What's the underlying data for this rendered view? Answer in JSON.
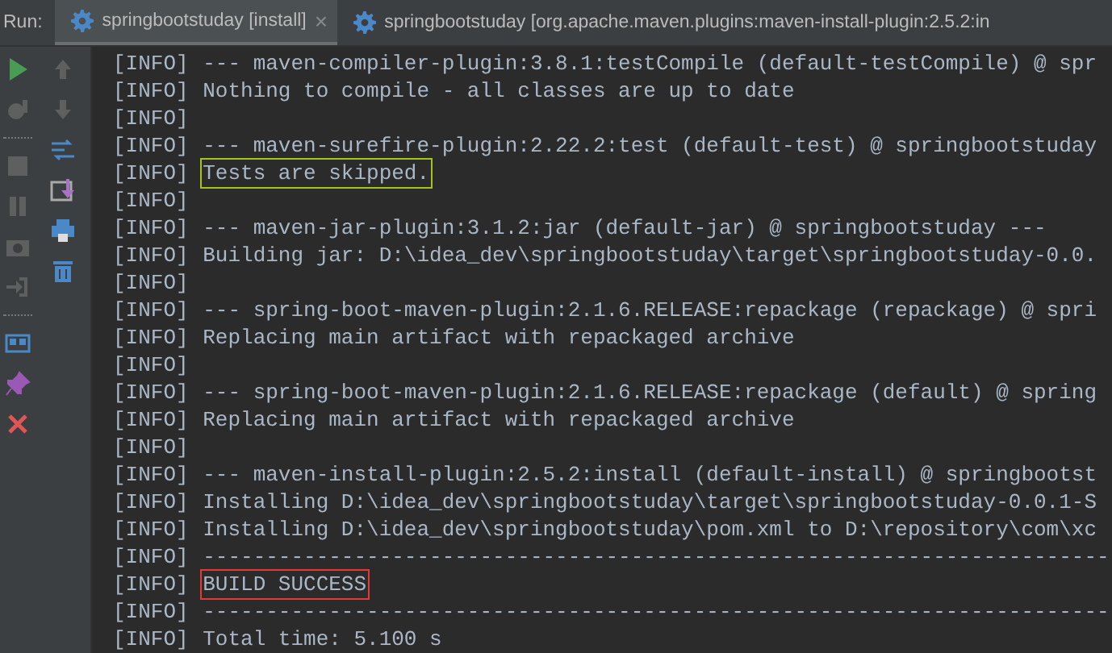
{
  "run_label": "Run:",
  "tabs": [
    {
      "label": "springbootstuday [install]",
      "selected": true,
      "close": "×"
    },
    {
      "label": "springbootstuday [org.apache.maven.plugins:maven-install-plugin:2.5.2:in",
      "selected": false
    }
  ],
  "log": [
    {
      "prefix": "[INFO]",
      "text": "--- maven-compiler-plugin:3.8.1:testCompile (default-testCompile) @ spr",
      "kind": "plain"
    },
    {
      "prefix": "[INFO]",
      "text": "Nothing to compile - all classes are up to date",
      "kind": "plain"
    },
    {
      "prefix": "[INFO]",
      "kind": "plain"
    },
    {
      "prefix": "[INFO]",
      "text": "--- maven-surefire-plugin:2.22.2:test (default-test) @ springbootstuday",
      "kind": "plain"
    },
    {
      "prefix": "[INFO]",
      "text": "Tests are skipped.",
      "kind": "boxed",
      "color": "#a5c41a"
    },
    {
      "prefix": "[INFO]",
      "kind": "plain"
    },
    {
      "prefix": "[INFO]",
      "text": "--- maven-jar-plugin:3.1.2:jar (default-jar) @ springbootstuday ---",
      "kind": "plain"
    },
    {
      "prefix": "[INFO]",
      "text": "Building jar: D:\\idea_dev\\springbootstuday\\target\\springbootstuday-0.0.",
      "kind": "plain"
    },
    {
      "prefix": "[INFO]",
      "kind": "plain"
    },
    {
      "prefix": "[INFO]",
      "text": "--- spring-boot-maven-plugin:2.1.6.RELEASE:repackage (repackage) @ spri",
      "kind": "plain"
    },
    {
      "prefix": "[INFO]",
      "text": "Replacing main artifact with repackaged archive",
      "kind": "plain"
    },
    {
      "prefix": "[INFO]",
      "kind": "plain"
    },
    {
      "prefix": "[INFO]",
      "text": "--- spring-boot-maven-plugin:2.1.6.RELEASE:repackage (default) @ spring",
      "kind": "plain"
    },
    {
      "prefix": "[INFO]",
      "text": "Replacing main artifact with repackaged archive",
      "kind": "plain"
    },
    {
      "prefix": "[INFO]",
      "kind": "plain"
    },
    {
      "prefix": "[INFO]",
      "text": "--- maven-install-plugin:2.5.2:install (default-install) @ springbootst",
      "kind": "plain"
    },
    {
      "prefix": "[INFO]",
      "text": "Installing D:\\idea_dev\\springbootstuday\\target\\springbootstuday-0.0.1-S",
      "kind": "plain"
    },
    {
      "prefix": "[INFO]",
      "text": "Installing D:\\idea_dev\\springbootstuday\\pom.xml to D:\\repository\\com\\xc",
      "kind": "plain"
    },
    {
      "prefix": "[INFO]",
      "text": "------------------------------------------------------------------------",
      "kind": "plain"
    },
    {
      "prefix": "[INFO]",
      "text": "BUILD SUCCESS",
      "kind": "boxed",
      "color": "#e53935"
    },
    {
      "prefix": "[INFO]",
      "text": "------------------------------------------------------------------------",
      "kind": "plain"
    },
    {
      "prefix": "[INFO]",
      "text": "Total time: 5.100 s",
      "kind": "plain"
    }
  ]
}
